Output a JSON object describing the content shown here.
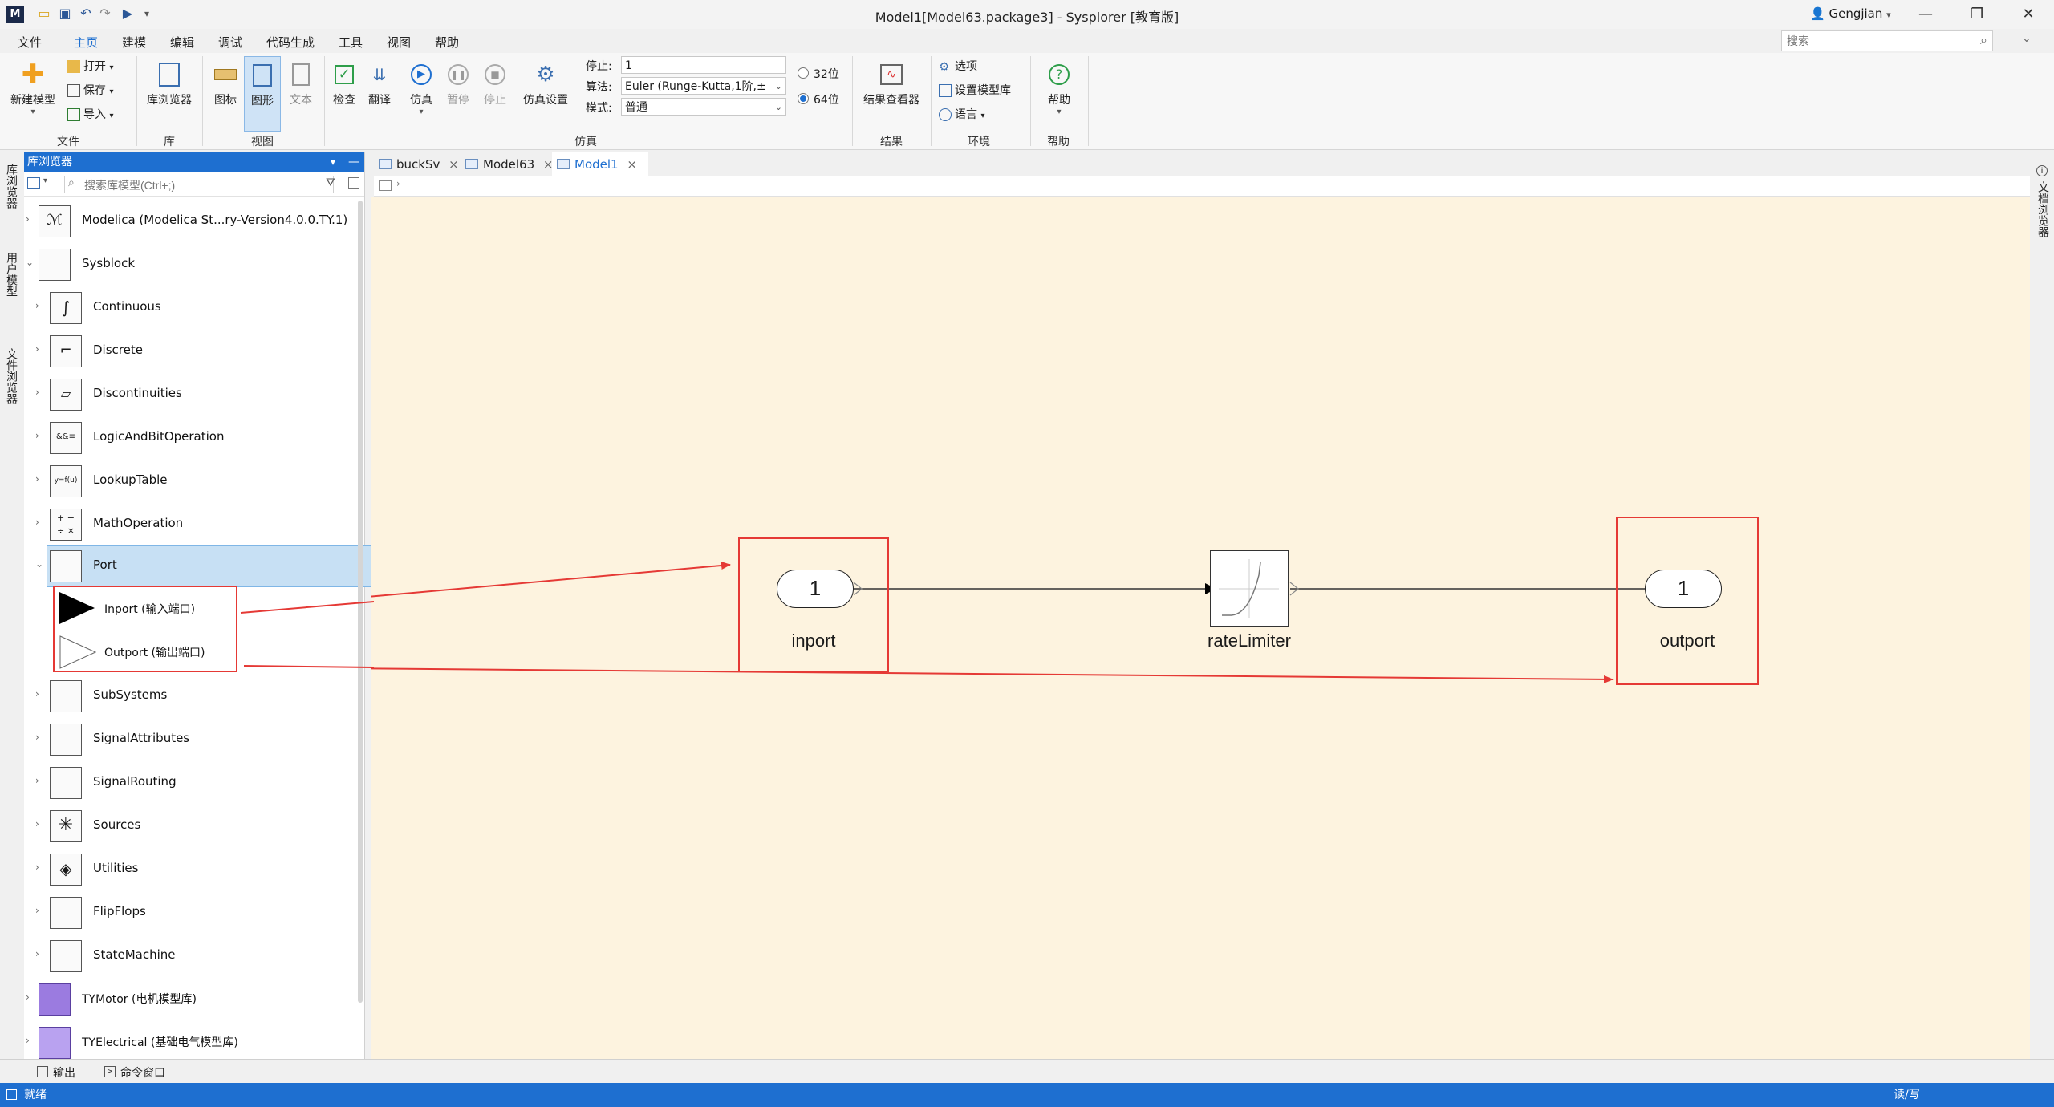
{
  "window": {
    "title": "Model1[Model63.package3] - Sysplorer [教育版]",
    "user": "Gengjian",
    "minimize": "—",
    "maximize": "❐",
    "close": "✕"
  },
  "menu": [
    "文件",
    "主页",
    "建模",
    "编辑",
    "调试",
    "代码生成",
    "工具",
    "视图",
    "帮助"
  ],
  "search": {
    "placeholder": "搜索"
  },
  "ribbon": {
    "file_group": {
      "new_model": "新建模型",
      "open": "打开",
      "save": "保存",
      "import": "导入",
      "label": "文件"
    },
    "lib_group": {
      "lib_browser": "库浏览器",
      "label": "库"
    },
    "view_group": {
      "icon": "图标",
      "diagram": "图形",
      "text": "文本",
      "label": "视图"
    },
    "sim_group": {
      "check": "检查",
      "translate": "翻译",
      "simulate": "仿真",
      "pause": "暂停",
      "stop": "停止",
      "settings": "仿真设置",
      "stop_label": "停止:",
      "stop_value": "1",
      "algo_label": "算法:",
      "algo_value": "Euler (Runge-Kutta,1阶,±",
      "mode_label": "模式:",
      "mode_value": "普通",
      "bit32": "32位",
      "bit64": "64位",
      "label": "仿真"
    },
    "result_group": {
      "viewer": "结果查看器",
      "label": "结果"
    },
    "env_group": {
      "options": "选项",
      "set_lib": "设置模型库",
      "language": "语言",
      "label": "环境"
    },
    "help_group": {
      "help": "帮助",
      "label": "帮助"
    }
  },
  "left_strip": [
    "库浏览器",
    "用户模型",
    "文件浏览器"
  ],
  "right_strip": [
    "文档浏览器"
  ],
  "library": {
    "header": "库浏览器",
    "search_placeholder": "搜索库模型(Ctrl+;)",
    "items": [
      {
        "label": "Modelica (Modelica St...ry-Version4.0.0.TY.1)",
        "arrow": "›"
      },
      {
        "label": "Sysblock",
        "arrow": "⌄"
      },
      {
        "label": "Continuous",
        "arrow": "›"
      },
      {
        "label": "Discrete",
        "arrow": "›"
      },
      {
        "label": "Discontinuities",
        "arrow": "›"
      },
      {
        "label": "LogicAndBitOperation",
        "arrow": "›"
      },
      {
        "label": "LookupTable",
        "arrow": "›"
      },
      {
        "label": "MathOperation",
        "arrow": "›"
      },
      {
        "label": "Port",
        "arrow": "⌄"
      },
      {
        "label": "Inport (输入端口)",
        "arrow": ""
      },
      {
        "label": "Outport (输出端口)",
        "arrow": ""
      },
      {
        "label": "SubSystems",
        "arrow": "›"
      },
      {
        "label": "SignalAttributes",
        "arrow": "›"
      },
      {
        "label": "SignalRouting",
        "arrow": "›"
      },
      {
        "label": "Sources",
        "arrow": "›"
      },
      {
        "label": "Utilities",
        "arrow": "›"
      },
      {
        "label": "FlipFlops",
        "arrow": "›"
      },
      {
        "label": "StateMachine",
        "arrow": "›"
      },
      {
        "label": "TYMotor (电机模型库)",
        "arrow": "›"
      },
      {
        "label": "TYElectrical (基础电气模型库)",
        "arrow": "›"
      }
    ],
    "icon_texts": {
      "logic": "&&≡",
      "lookup": "y=f(u)",
      "math": "+ −\n÷ ×"
    }
  },
  "tabs": [
    {
      "label": "buckSv"
    },
    {
      "label": "Model63"
    },
    {
      "label": "Model1"
    }
  ],
  "tab_close": "×",
  "diagram": {
    "inport": {
      "value": "1",
      "label": "inport"
    },
    "rate_limiter": {
      "label": "rateLimiter"
    },
    "outport": {
      "value": "1",
      "label": "outport"
    }
  },
  "bottom_tabs": {
    "output": "输出",
    "command": "命令窗口"
  },
  "status": {
    "left": "就绪",
    "right": "读/写"
  },
  "colors": {
    "accent": "#1e6fd0",
    "canvas": "#fdf3df",
    "highlight": "#e53935"
  }
}
